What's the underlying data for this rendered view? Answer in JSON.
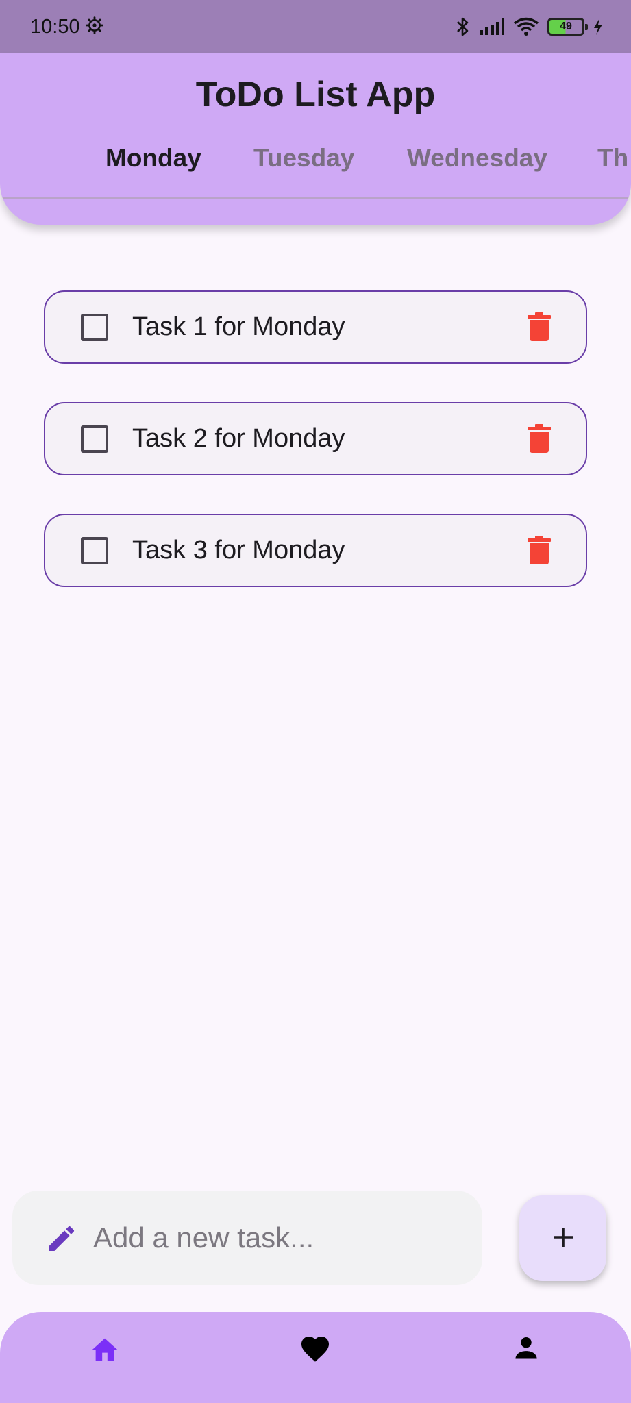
{
  "status_bar": {
    "time": "10:50",
    "battery_level": "49",
    "icons": [
      "settings-gear-icon",
      "bluetooth-icon",
      "signal-icon",
      "wifi-icon",
      "battery-icon",
      "charging-icon"
    ]
  },
  "header": {
    "title": "ToDo List App",
    "tabs": [
      {
        "label": "Monday",
        "active": true
      },
      {
        "label": "Tuesday",
        "active": false
      },
      {
        "label": "Wednesday",
        "active": false
      },
      {
        "label": "Th",
        "active": false
      }
    ]
  },
  "tasks": [
    {
      "label": "Task 1 for Monday",
      "checked": false
    },
    {
      "label": "Task 2 for Monday",
      "checked": false
    },
    {
      "label": "Task 3 for Monday",
      "checked": false
    }
  ],
  "add_task": {
    "placeholder": "Add a new task...",
    "value": "",
    "icon": "edit-pencil-icon",
    "button_icon": "plus-icon"
  },
  "bottom_nav": {
    "items": [
      {
        "icon": "home-icon",
        "active": true
      },
      {
        "icon": "heart-icon",
        "active": false
      },
      {
        "icon": "person-icon",
        "active": false
      }
    ]
  },
  "colors": {
    "header_bg": "#cfa9f5",
    "status_bar_bg": "#9c7fb6",
    "accent": "#6a3bbf",
    "delete": "#f44336",
    "background": "#fbf6fd"
  }
}
